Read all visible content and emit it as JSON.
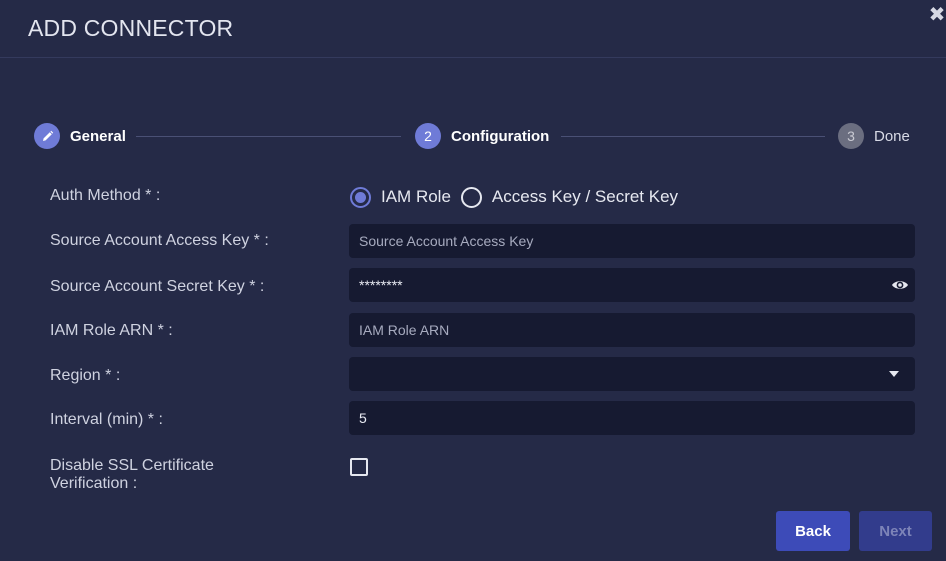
{
  "dialog": {
    "title": "ADD CONNECTOR",
    "close_icon": "close-icon"
  },
  "stepper": {
    "steps": [
      {
        "label": "General",
        "icon": "pencil-icon",
        "state": "completed"
      },
      {
        "label": "Configuration",
        "number": "2",
        "state": "active"
      },
      {
        "label": "Done",
        "number": "3",
        "state": "pending"
      }
    ]
  },
  "form": {
    "auth_method": {
      "label": "Auth Method * :",
      "options": [
        "IAM Role",
        "Access Key / Secret Key"
      ],
      "selected": "IAM Role"
    },
    "access_key": {
      "label": "Source Account Access Key * :",
      "placeholder": "Source Account Access Key",
      "value": ""
    },
    "secret_key": {
      "label": "Source Account Secret Key * :",
      "value": "********",
      "icon": "eye-icon"
    },
    "iam_role_arn": {
      "label": "IAM Role ARN * :",
      "placeholder": "IAM Role ARN",
      "value": ""
    },
    "region": {
      "label": "Region * :",
      "value": ""
    },
    "interval": {
      "label": "Interval (min) * :",
      "value": "5"
    },
    "disable_ssl": {
      "label_line1": "Disable SSL Certificate",
      "label_line2": "Verification  :",
      "checked": false
    }
  },
  "buttons": {
    "back": "Back",
    "next": "Next"
  },
  "colors": {
    "background": "#252a47",
    "field_bg": "#161a31",
    "accent": "#6f7bd7",
    "primary_button": "#3d4bb8"
  }
}
